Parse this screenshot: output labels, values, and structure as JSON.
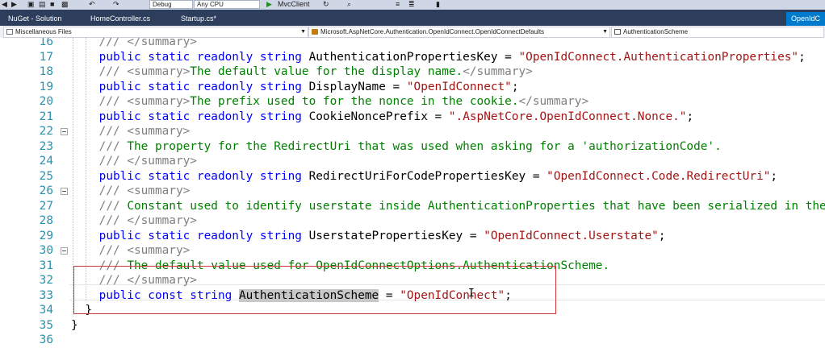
{
  "toolbar": {
    "config": "Debug",
    "platform": "Any CPU",
    "run_target": "MvcClient"
  },
  "tabs": [
    {
      "label": "NuGet - Solution"
    },
    {
      "label": "HomeController.cs"
    },
    {
      "label": "Startup.cs*"
    },
    {
      "label": "OpenIdC"
    }
  ],
  "navbar": {
    "project": "Miscellaneous Files",
    "type": "Microsoft.AspNetCore.Authentication.OpenIdConnect.OpenIdConnectDefaults",
    "member": "AuthenticationScheme"
  },
  "code": {
    "lines": [
      {
        "num": "16",
        "doc": "/// ",
        "tag": "</summary>",
        "fold": false
      },
      {
        "num": "17",
        "kw": "public static readonly string ",
        "name": "AuthenticationPropertiesKey",
        "eq": " = ",
        "str": "\"OpenIdConnect.AuthenticationProperties\"",
        "end": ";"
      },
      {
        "num": "18",
        "doc": "/// ",
        "tag": "<summary>",
        "text": "The default value for the display name.",
        "tag2": "</summary>"
      },
      {
        "num": "19",
        "kw": "public static readonly string ",
        "name": "DisplayName",
        "eq": " = ",
        "str": "\"OpenIdConnect\"",
        "end": ";"
      },
      {
        "num": "20",
        "doc": "/// ",
        "tag": "<summary>",
        "text": "The prefix used to for the nonce in the cookie.",
        "tag2": "</summary>"
      },
      {
        "num": "21",
        "kw": "public static readonly string ",
        "name": "CookieNoncePrefix",
        "eq": " = ",
        "str": "\".AspNetCore.OpenIdConnect.Nonce.\"",
        "end": ";"
      },
      {
        "num": "22",
        "doc": "/// ",
        "tag": "<summary>",
        "fold": true
      },
      {
        "num": "23",
        "doc": "/// ",
        "text": "The property for the RedirectUri that was used when asking for a 'authorizationCode'."
      },
      {
        "num": "24",
        "doc": "/// ",
        "tag": "</summary>"
      },
      {
        "num": "25",
        "kw": "public static readonly string ",
        "name": "RedirectUriForCodePropertiesKey",
        "eq": " = ",
        "str": "\"OpenIdConnect.Code.RedirectUri\"",
        "end": ";"
      },
      {
        "num": "26",
        "doc": "/// ",
        "tag": "<summary>",
        "fold": true
      },
      {
        "num": "27",
        "doc": "/// ",
        "text": "Constant used to identify userstate inside AuthenticationProperties that have been serialized in the"
      },
      {
        "num": "28",
        "doc": "/// ",
        "tag": "</summary>"
      },
      {
        "num": "29",
        "kw": "public static readonly string ",
        "name": "UserstatePropertiesKey",
        "eq": " = ",
        "str": "\"OpenIdConnect.Userstate\"",
        "end": ";"
      },
      {
        "num": "30",
        "doc": "/// ",
        "tag": "<summary>",
        "fold": true
      },
      {
        "num": "31",
        "doc": "/// ",
        "text": "The default value used for OpenIdConnectOptions.AuthenticationScheme."
      },
      {
        "num": "32",
        "doc": "/// ",
        "tag": "</summary>"
      },
      {
        "num": "33",
        "kw": "public const string ",
        "name": "AuthenticationScheme",
        "eq": " = ",
        "str": "\"OpenIdConnect\"",
        "end": ";"
      },
      {
        "num": "34",
        "plain": "}"
      },
      {
        "num": "35",
        "plain": "}"
      },
      {
        "num": "36",
        "plain": ""
      }
    ]
  },
  "colors": {
    "keyword": "#0000ff",
    "string": "#a31515",
    "comment": "#008000",
    "doc_tag": "#808080",
    "line_number": "#2b91af",
    "tab_bar": "#2d3e5c",
    "selection_box": "#d03a3a"
  }
}
